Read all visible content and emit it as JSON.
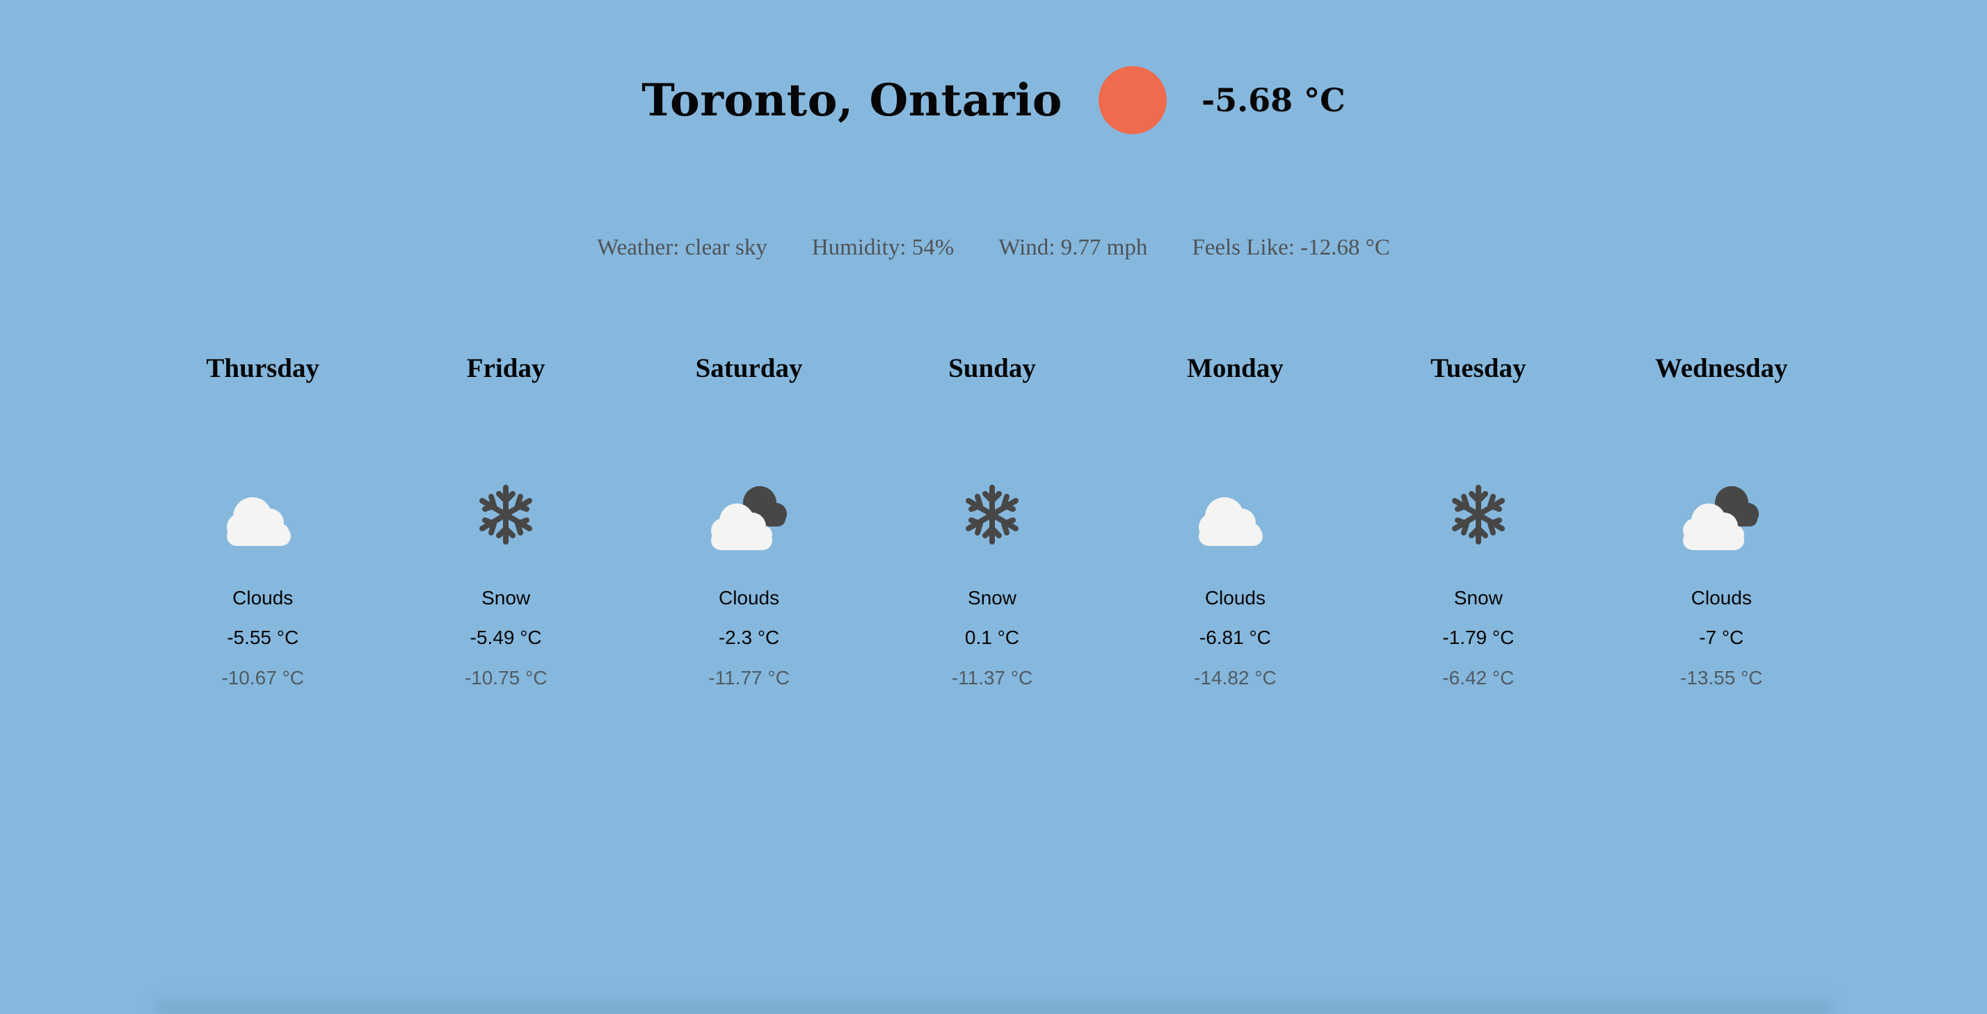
{
  "current": {
    "location": "Toronto, Ontario",
    "temperature": "-5.68 °C",
    "icon": "clear-sky-sun-icon",
    "sun_color": "#ef6b4d",
    "weather": "Weather: clear sky",
    "humidity": "Humidity: 54%",
    "wind": "Wind: 9.77 mph",
    "feels_like": "Feels Like: -12.68 °C"
  },
  "forecast": [
    {
      "day": "Thursday",
      "icon": "cloud-icon",
      "condition": "Clouds",
      "high": "-5.55 °C",
      "low": "-10.67 °C"
    },
    {
      "day": "Friday",
      "icon": "snowflake-icon",
      "condition": "Snow",
      "high": "-5.49 °C",
      "low": "-10.75 °C"
    },
    {
      "day": "Saturday",
      "icon": "broken-clouds-icon",
      "condition": "Clouds",
      "high": "-2.3 °C",
      "low": "-11.77 °C"
    },
    {
      "day": "Sunday",
      "icon": "snowflake-icon",
      "condition": "Snow",
      "high": "0.1 °C",
      "low": "-11.37 °C"
    },
    {
      "day": "Monday",
      "icon": "cloud-icon",
      "condition": "Clouds",
      "high": "-6.81 °C",
      "low": "-14.82 °C"
    },
    {
      "day": "Tuesday",
      "icon": "snowflake-icon",
      "condition": "Snow",
      "high": "-1.79 °C",
      "low": "-6.42 °C"
    },
    {
      "day": "Wednesday",
      "icon": "broken-clouds-icon",
      "condition": "Clouds",
      "high": "-7 °C",
      "low": "-13.55 °C"
    }
  ],
  "colors": {
    "background": "#86b8de",
    "cloud": "#f4f4f2",
    "dark_cloud": "#474747",
    "snowflake": "#474747"
  }
}
